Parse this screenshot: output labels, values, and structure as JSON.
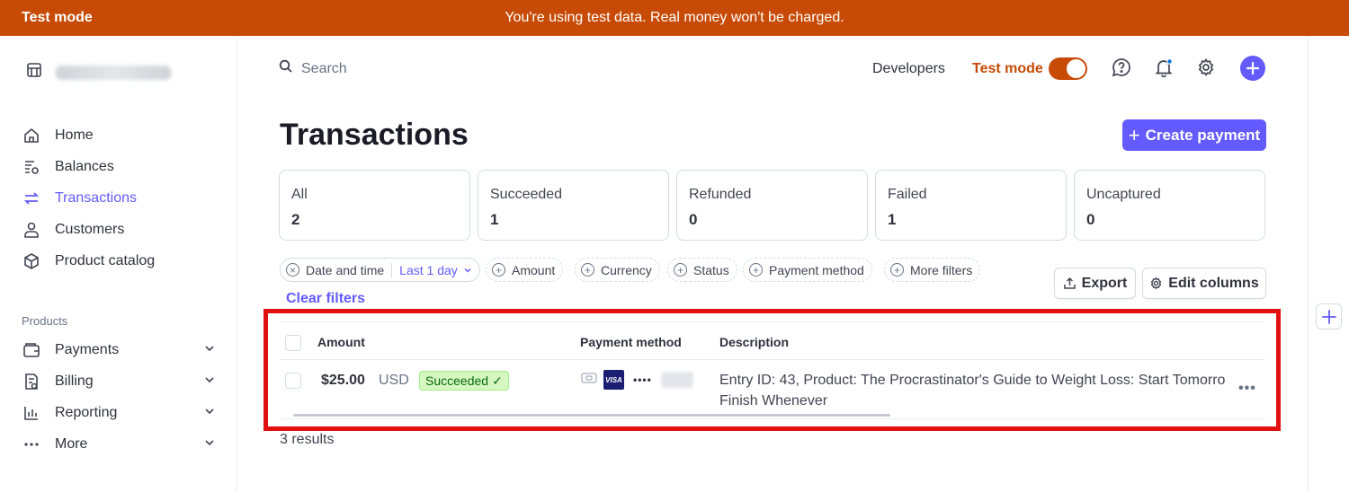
{
  "banner": {
    "mode_label": "Test mode",
    "message": "You're using test data. Real money won't be charged."
  },
  "sidebar": {
    "items": [
      {
        "label": "Home",
        "icon": "home-icon"
      },
      {
        "label": "Balances",
        "icon": "balances-icon"
      },
      {
        "label": "Transactions",
        "icon": "transactions-icon",
        "active": true
      },
      {
        "label": "Customers",
        "icon": "customers-icon"
      },
      {
        "label": "Product catalog",
        "icon": "product-catalog-icon"
      }
    ],
    "products_label": "Products",
    "product_items": [
      {
        "label": "Payments",
        "icon": "payments-icon"
      },
      {
        "label": "Billing",
        "icon": "billing-icon"
      },
      {
        "label": "Reporting",
        "icon": "reporting-icon"
      },
      {
        "label": "More",
        "icon": "more-icon"
      }
    ]
  },
  "header": {
    "search_placeholder": "Search",
    "developers": "Developers",
    "test_mode": "Test mode",
    "test_mode_on": true
  },
  "page": {
    "title": "Transactions",
    "create_button": "Create payment"
  },
  "status_cards": [
    {
      "label": "All",
      "count": "2"
    },
    {
      "label": "Succeeded",
      "count": "1"
    },
    {
      "label": "Refunded",
      "count": "0"
    },
    {
      "label": "Failed",
      "count": "1"
    },
    {
      "label": "Uncaptured",
      "count": "0"
    }
  ],
  "filters": {
    "date_label": "Date and time",
    "date_value": "Last 1 day",
    "amount": "Amount",
    "currency": "Currency",
    "status": "Status",
    "payment_method": "Payment method",
    "more": "More filters",
    "clear": "Clear filters",
    "export": "Export",
    "edit_columns": "Edit columns"
  },
  "table": {
    "headers": {
      "amount": "Amount",
      "payment_method": "Payment method",
      "description": "Description"
    },
    "rows": [
      {
        "amount": "$25.00",
        "currency": "USD",
        "status": "Succeeded",
        "card_brand": "VISA",
        "card_mask": "••••",
        "description_line1": "Entry ID: 43, Product: The Procrastinator's Guide to Weight Loss: Start Tomorro",
        "description_line2": "Finish Whenever"
      }
    ],
    "results": "3 results"
  },
  "colors": {
    "banner": "#c74b06",
    "accent": "#635bff",
    "success_bg": "#d7f7c2",
    "success_text": "#05690d",
    "highlight": "#e01010"
  }
}
